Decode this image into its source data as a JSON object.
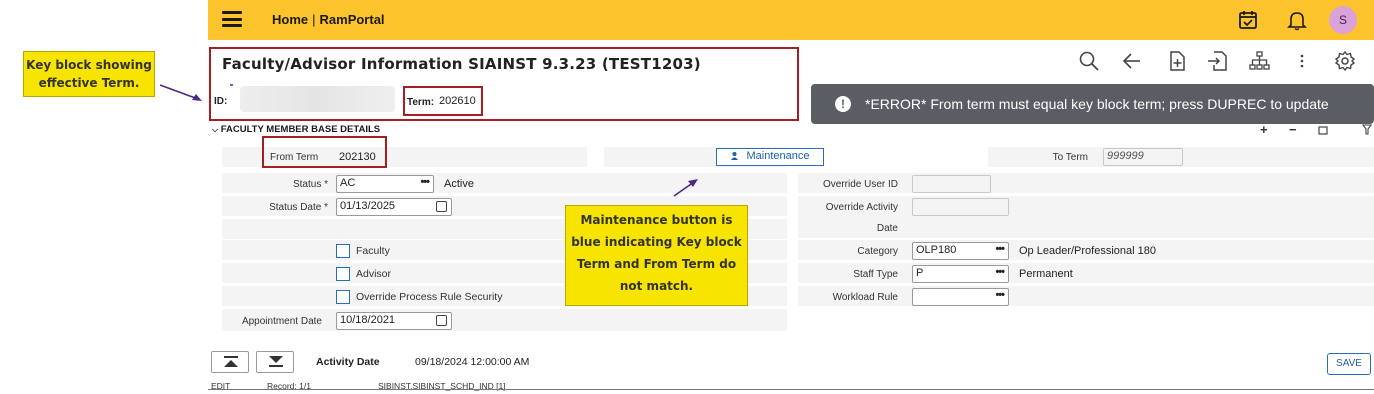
{
  "callouts": {
    "key_block": "Key block showing effective Term.",
    "maintenance": "Maintenance button is blue indicating Key block Term and From Term do not match."
  },
  "topbar": {
    "home": "Home",
    "separator": "|",
    "portal": "RamPortal",
    "avatar_initial": "S",
    "bg_color": "#fcc32c"
  },
  "header": {
    "title": "Faculty/Advisor Information SIAINST 9.3.23 (TEST1203)",
    "id_label": "ID:",
    "term_label": "Term:",
    "term_value": "202610"
  },
  "toolbar_icons": [
    "search-icon",
    "back-arrow-icon",
    "add-document-icon",
    "export-icon",
    "related-tree-icon",
    "more-icon",
    "settings-icon"
  ],
  "error_toast": {
    "icon": "!",
    "message": "*ERROR* From term must equal key block term; press DUPREC to update"
  },
  "section": {
    "title": "FACULTY MEMBER BASE DETAILS",
    "add": "+",
    "remove": "−"
  },
  "form": {
    "from_term_label": "From Term",
    "from_term_value": "202130",
    "maintenance_label": "Maintenance",
    "to_term_label": "To Term",
    "to_term_value": "999999",
    "status_label": "Status *",
    "status_value": "AC",
    "status_desc": "Active",
    "status_date_label": "Status Date *",
    "status_date_value": "01/13/2025",
    "faculty_label": "Faculty",
    "advisor_label": "Advisor",
    "override_rule_label": "Override Process Rule Security",
    "appointment_date_label": "Appointment Date",
    "appointment_date_value": "10/18/2021",
    "override_user_label": "Override User ID",
    "override_activity_label": "Override Activity",
    "override_activity_label2": "Date",
    "category_label": "Category",
    "category_value": "OLP180",
    "category_desc": "Op Leader/Professional 180",
    "staff_type_label": "Staff Type",
    "staff_type_value": "P",
    "staff_type_desc": "Permanent",
    "workload_label": "Workload Rule"
  },
  "footer": {
    "activity_label": "Activity Date",
    "activity_value": "09/18/2024 12:00:00 AM",
    "save": "SAVE",
    "mode": "EDIT",
    "record": "Record: 1/1",
    "block": "SIBINST.SIBINST_SCHD_IND [1]"
  }
}
